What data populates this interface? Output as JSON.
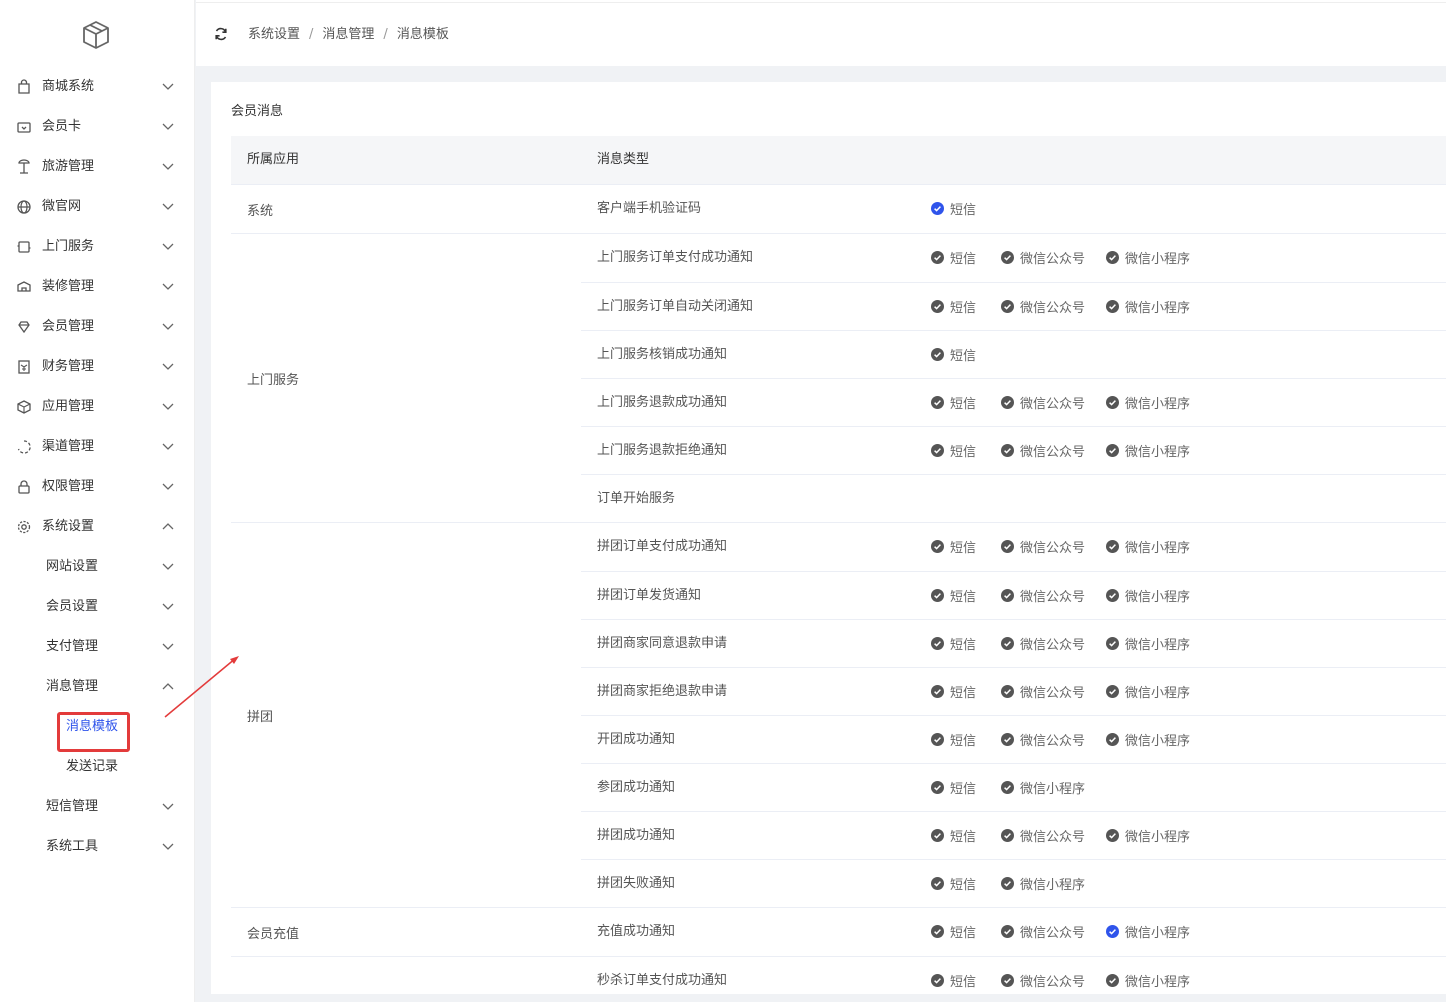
{
  "colors": {
    "accent": "#2f54eb",
    "highlight_border": "#e33b3b",
    "check_gray": "#555555",
    "check_blue": "#2f54eb"
  },
  "sidebar": {
    "logo_icon": "cube-icon",
    "items": [
      {
        "label": "商城系统",
        "icon": "shopping-bag-icon",
        "chev": "down"
      },
      {
        "label": "会员卡",
        "icon": "member-card-icon",
        "chev": "down"
      },
      {
        "label": "旅游管理",
        "icon": "travel-icon",
        "chev": "down"
      },
      {
        "label": "微官网",
        "icon": "globe-icon",
        "chev": "down"
      },
      {
        "label": "上门服务",
        "icon": "service-icon",
        "chev": "down"
      },
      {
        "label": "装修管理",
        "icon": "decoration-icon",
        "chev": "down"
      },
      {
        "label": "会员管理",
        "icon": "diamond-icon",
        "chev": "down"
      },
      {
        "label": "财务管理",
        "icon": "finance-icon",
        "chev": "down"
      },
      {
        "label": "应用管理",
        "icon": "app-icon",
        "chev": "down"
      },
      {
        "label": "渠道管理",
        "icon": "channel-icon",
        "chev": "down"
      },
      {
        "label": "权限管理",
        "icon": "lock-icon",
        "chev": "down"
      },
      {
        "label": "系统设置",
        "icon": "gear-icon",
        "chev": "up"
      }
    ],
    "sub_items": [
      {
        "label": "网站设置",
        "chev": "down"
      },
      {
        "label": "会员设置",
        "chev": "down"
      },
      {
        "label": "支付管理",
        "chev": "down"
      },
      {
        "label": "消息管理",
        "chev": "up"
      }
    ],
    "leaf_items": [
      {
        "label": "消息模板",
        "active": true
      },
      {
        "label": "发送记录",
        "active": false
      }
    ],
    "sub_items_after": [
      {
        "label": "短信管理",
        "chev": "down"
      },
      {
        "label": "系统工具",
        "chev": "down"
      }
    ]
  },
  "breadcrumb": {
    "items": [
      "系统设置",
      "消息管理",
      "消息模板"
    ],
    "separator": "/"
  },
  "section_title": "会员消息",
  "table": {
    "headers": {
      "app": "所属应用",
      "type": "消息类型"
    },
    "groups": [
      {
        "app": "系统",
        "rows": [
          {
            "name": "客户端手机验证码",
            "channels": [
              {
                "label": "短信",
                "checked_color": "blue"
              }
            ]
          }
        ]
      },
      {
        "app": "上门服务",
        "rows": [
          {
            "name": "上门服务订单支付成功通知",
            "channels": [
              {
                "label": "短信",
                "checked_color": "gray"
              },
              {
                "label": "微信公众号",
                "checked_color": "gray"
              },
              {
                "label": "微信小程序",
                "checked_color": "gray"
              }
            ]
          },
          {
            "name": "上门服务订单自动关闭通知",
            "channels": [
              {
                "label": "短信",
                "checked_color": "gray"
              },
              {
                "label": "微信公众号",
                "checked_color": "gray"
              },
              {
                "label": "微信小程序",
                "checked_color": "gray"
              }
            ]
          },
          {
            "name": "上门服务核销成功通知",
            "channels": [
              {
                "label": "短信",
                "checked_color": "gray"
              }
            ]
          },
          {
            "name": "上门服务退款成功通知",
            "channels": [
              {
                "label": "短信",
                "checked_color": "gray"
              },
              {
                "label": "微信公众号",
                "checked_color": "gray"
              },
              {
                "label": "微信小程序",
                "checked_color": "gray"
              }
            ]
          },
          {
            "name": "上门服务退款拒绝通知",
            "channels": [
              {
                "label": "短信",
                "checked_color": "gray"
              },
              {
                "label": "微信公众号",
                "checked_color": "gray"
              },
              {
                "label": "微信小程序",
                "checked_color": "gray"
              }
            ]
          },
          {
            "name": "订单开始服务",
            "channels": []
          }
        ]
      },
      {
        "app": "拼团",
        "rows": [
          {
            "name": "拼团订单支付成功通知",
            "channels": [
              {
                "label": "短信",
                "checked_color": "gray"
              },
              {
                "label": "微信公众号",
                "checked_color": "gray"
              },
              {
                "label": "微信小程序",
                "checked_color": "gray"
              }
            ]
          },
          {
            "name": "拼团订单发货通知",
            "channels": [
              {
                "label": "短信",
                "checked_color": "gray"
              },
              {
                "label": "微信公众号",
                "checked_color": "gray"
              },
              {
                "label": "微信小程序",
                "checked_color": "gray"
              }
            ]
          },
          {
            "name": "拼团商家同意退款申请",
            "channels": [
              {
                "label": "短信",
                "checked_color": "gray"
              },
              {
                "label": "微信公众号",
                "checked_color": "gray"
              },
              {
                "label": "微信小程序",
                "checked_color": "gray"
              }
            ]
          },
          {
            "name": "拼团商家拒绝退款申请",
            "channels": [
              {
                "label": "短信",
                "checked_color": "gray"
              },
              {
                "label": "微信公众号",
                "checked_color": "gray"
              },
              {
                "label": "微信小程序",
                "checked_color": "gray"
              }
            ]
          },
          {
            "name": "开团成功通知",
            "channels": [
              {
                "label": "短信",
                "checked_color": "gray"
              },
              {
                "label": "微信公众号",
                "checked_color": "gray"
              },
              {
                "label": "微信小程序",
                "checked_color": "gray"
              }
            ]
          },
          {
            "name": "参团成功通知",
            "channels": [
              {
                "label": "短信",
                "checked_color": "gray"
              },
              {
                "label": "微信小程序",
                "checked_color": "gray"
              }
            ]
          },
          {
            "name": "拼团成功通知",
            "channels": [
              {
                "label": "短信",
                "checked_color": "gray"
              },
              {
                "label": "微信公众号",
                "checked_color": "gray"
              },
              {
                "label": "微信小程序",
                "checked_color": "gray"
              }
            ]
          },
          {
            "name": "拼团失败通知",
            "channels": [
              {
                "label": "短信",
                "checked_color": "gray"
              },
              {
                "label": "微信小程序",
                "checked_color": "gray"
              }
            ]
          }
        ]
      },
      {
        "app": "会员充值",
        "rows": [
          {
            "name": "充值成功通知",
            "channels": [
              {
                "label": "短信",
                "checked_color": "gray"
              },
              {
                "label": "微信公众号",
                "checked_color": "gray"
              },
              {
                "label": "微信小程序",
                "checked_color": "blue"
              }
            ]
          }
        ]
      },
      {
        "app": "",
        "rows": [
          {
            "name": "秒杀订单支付成功通知",
            "channels": [
              {
                "label": "短信",
                "checked_color": "gray"
              },
              {
                "label": "微信公众号",
                "checked_color": "gray"
              },
              {
                "label": "微信小程序",
                "checked_color": "gray"
              }
            ]
          }
        ]
      }
    ]
  }
}
